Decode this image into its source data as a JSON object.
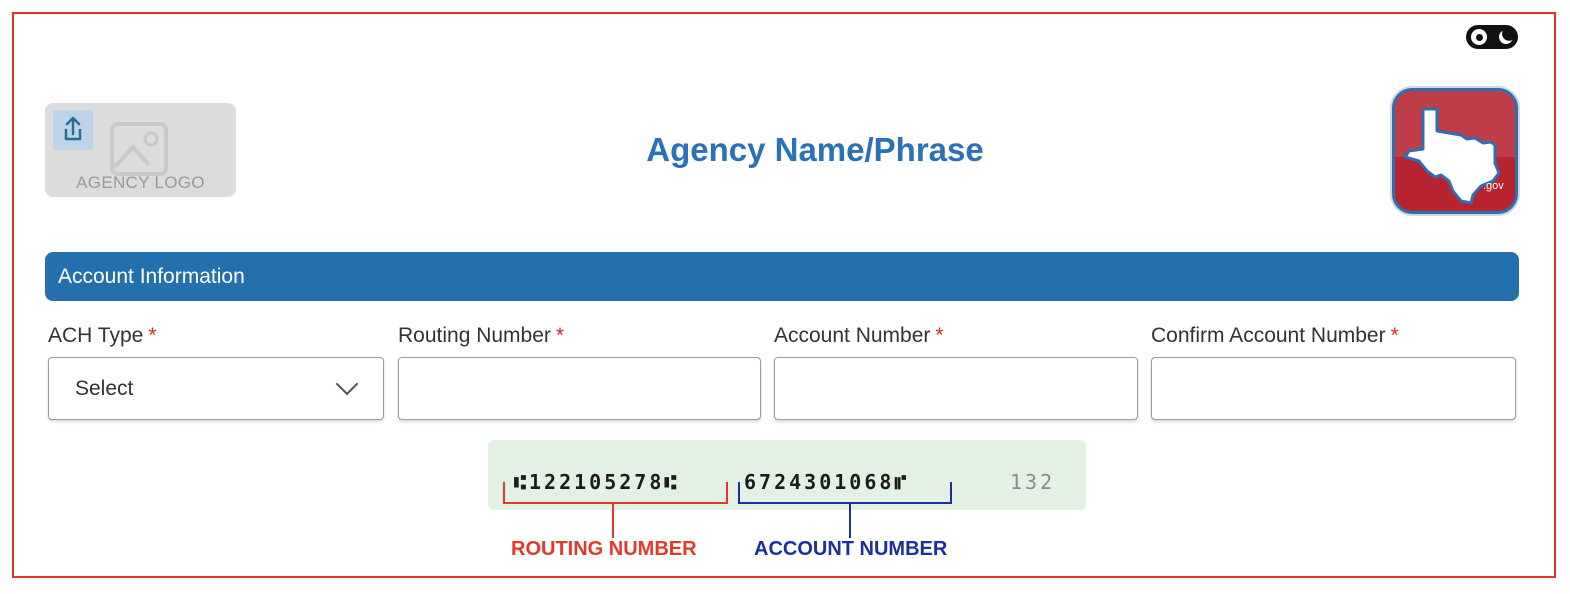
{
  "header": {
    "logo_placeholder_label": "AGENCY LOGO",
    "title": "Agency Name/Phrase",
    "badge_label": ".gov",
    "theme_toggle_icon": "sun-moon-toggle-icon"
  },
  "section": {
    "title": "Account Information"
  },
  "fields": {
    "ach_type": {
      "label": "ACH Type",
      "required_marker": "*",
      "value": "Select"
    },
    "routing_number": {
      "label": "Routing Number",
      "required_marker": "*",
      "value": ""
    },
    "account_number": {
      "label": "Account Number",
      "required_marker": "*",
      "value": ""
    },
    "confirm_account_number": {
      "label": "Confirm Account Number",
      "required_marker": "*",
      "value": ""
    }
  },
  "check_diagram": {
    "routing_digits": "⑆122105278⑆",
    "account_digits": "6724301068⑈",
    "check_digits": "132",
    "routing_caption": "ROUTING NUMBER",
    "account_caption": "ACCOUNT NUMBER"
  },
  "colors": {
    "accent": "#2370ac",
    "title": "#2a72b5",
    "required": "#d42a2a",
    "routing": "#e23a2a",
    "account": "#1c2ea0",
    "frame": "#d9372a"
  }
}
